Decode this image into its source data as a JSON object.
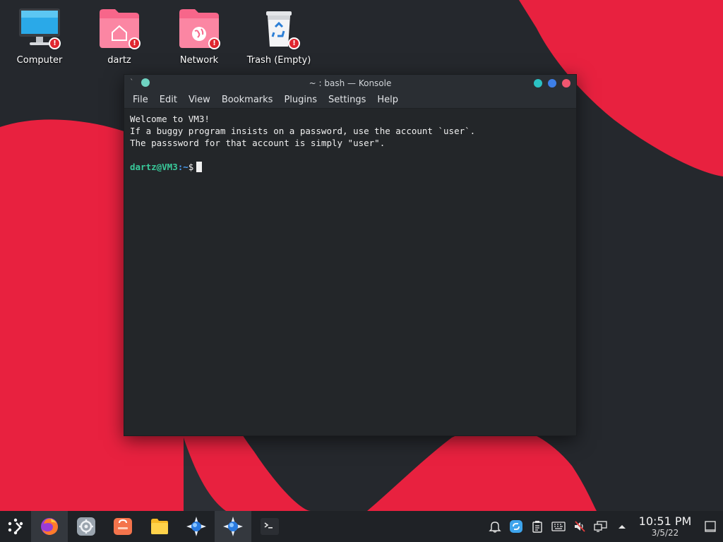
{
  "colors": {
    "accent_red": "#e8213f",
    "wallpaper_dark": "#25282d",
    "terminal_bg": "#232629",
    "prompt_user": "#39c99a",
    "prompt_path": "#4a9ff5",
    "folder_pink": "#f7668a"
  },
  "desktop": {
    "icons": [
      {
        "label": "Computer",
        "icon": "computer-icon"
      },
      {
        "label": "dartz",
        "icon": "home-folder-icon"
      },
      {
        "label": "Network",
        "icon": "network-folder-icon"
      },
      {
        "label": "Trash (Empty)",
        "icon": "trash-icon"
      }
    ]
  },
  "window": {
    "title": "~ : bash — Konsole",
    "menu": [
      "File",
      "Edit",
      "View",
      "Bookmarks",
      "Plugins",
      "Settings",
      "Help"
    ],
    "terminal": {
      "lines": [
        "Welcome to VM3!",
        "If a buggy program insists on a password, use the account `user`.",
        "The passsword for that account is simply \"user\"."
      ],
      "prompt_user": "dartz@VM3",
      "prompt_path": ":~",
      "prompt_symbol": "$"
    }
  },
  "taskbar": {
    "launcher_icon": "app-launcher-icon",
    "apps": [
      {
        "name": "firefox-icon",
        "active": true
      },
      {
        "name": "system-settings-icon",
        "active": false
      },
      {
        "name": "software-store-icon",
        "active": false
      },
      {
        "name": "file-manager-icon",
        "active": false
      },
      {
        "name": "krdc-icon",
        "active": false
      },
      {
        "name": "krdc-icon",
        "active": true
      },
      {
        "name": "konsole-icon",
        "active": false
      }
    ],
    "tray": [
      "notifications-icon",
      "updates-icon",
      "clipboard-icon",
      "keyboard-icon",
      "volume-muted-icon",
      "network-icon",
      "tray-expand-icon"
    ],
    "clock": {
      "time": "10:51 PM",
      "date": "3/5/22"
    },
    "show_desktop_icon": "show-desktop-icon"
  }
}
